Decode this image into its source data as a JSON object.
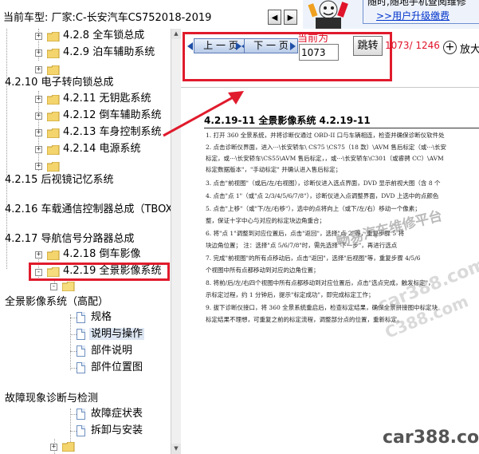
{
  "header": {
    "vehicle_line": "当前车型:  厂家:C-长安汽车CS752018-2019",
    "nav_left_glyph": "◀",
    "nav_right_glyph": "▶",
    "banner_line1": "随时,随地手机查阅维修",
    "banner_line2": ">>用户升级缴费"
  },
  "tree": {
    "rows": [
      {
        "label": "4.2.8 全车锁总成"
      },
      {
        "label": "4.2.9 泊车辅助系统"
      },
      {
        "label": "4.2.10 电子转向锁总成"
      },
      {
        "label": "4.2.11 无钥匙系统"
      },
      {
        "label": "4.2.12 倒车辅助系统"
      },
      {
        "label": "4.2.13 车身控制系统"
      },
      {
        "label": "4.2.14 电源系统"
      },
      {
        "label": "4.2.15 后视镜记忆系统"
      },
      {
        "label": "4.2.16 车载通信控制器总成（TBOX"
      },
      {
        "label": "4.2.17 导航信号分路器总成"
      },
      {
        "label": "4.2.18 倒车影像"
      },
      {
        "label": "4.2.19 全景影像系统"
      },
      {
        "label": "全景影像系统（高配）"
      },
      {
        "label": "规格"
      },
      {
        "label": "说明与操作"
      },
      {
        "label": "部件说明"
      },
      {
        "label": "部件位置图"
      },
      {
        "label": "故障现象诊断与检测"
      },
      {
        "label": "故障症状表"
      },
      {
        "label": "拆卸与安装"
      }
    ],
    "collapsed_glyph": "+",
    "expanded_glyph": "-"
  },
  "toolbar": {
    "prev_label": "上 一 页",
    "next_label": "下 一 页",
    "current_label": "当前为",
    "page_value": "1073",
    "jump_label": "跳转",
    "page_count": "1073/ 1246",
    "zoom_glyph": "+",
    "zoom_label": "放大"
  },
  "page": {
    "heading": "4.2.19-11 全景影像系统 4.2.19-11",
    "steps": [
      "1.  打开 360 全景系统，并将诊断仪通过 OBD-II 口与车辆相连，检查并确保诊断仪软件处",
      "2.  点击诊断仪界面，进入···\\长安轿车\\ CS75 \\CS75（18 款）\\AVM 售后标定（或···\\长安",
      "    标定，或···\\长安轿车\\CS55\\AVM 售后标定，，或···\\长安轿车\\C301（或睿骋 CC）\\AVM",
      "    标定数据版本\"，\"手动标定\"  并确认进入售后标定；",
      "3.  点击\"前视图\"（或后/左/右视图），诊断仪进入选点界面，DVD 显示前视大图（含 8 个",
      "4.  点击\"点 1\"（或\"点 2/3/4/5/6/7/8\"），诊断仪进入点调整界面，DVD 上选中的点颜色",
      "5.  点击\"上移\"（或\"下/左/右移\"），选中的点将向上（或下/左/右）移动一个像素；",
      "    整，保证十字中心与对应的标定块边角重合；",
      "6.  将\"点 1\"调整到对应位置后，点击\"返回\"，选择\"点 2\"等，重复步骤 5 将",
      "    块边角位置；  注：选择\"点 5/6/7/8\"时，需先选择\"下一步\"，再进行选点",
      "7.  完成\"前视图\"的所有点移动后，点击\"返回\"，选择\"后视图\"等，重复步骤 4/5/6",
      "    个视图中所有点都移动到对应的边角位置；",
      "8.  将前/后/左/右四个视图中所有点都移动到对应位置后，点击\"选点完成，触发标定\"，",
      "    示标定过程，约 1 分钟后，提示\"标定成功\"，即完成标定工作；",
      "9.  拔下诊断仪接口，将 360 全景系统重启后，检查标定结果，确保全景拼接图中标定块",
      "    标定结果不理想，可重复之前的标定流程，调整部分点的位置，重新标定。"
    ]
  },
  "watermarks": {
    "main": "畅易汽车维修平台",
    "site": "car388.com",
    "faint_1": "car388.com",
    "faint_2": "C388.com"
  },
  "colors": {
    "highlight": "#e01b2c",
    "page_count": "#e0142a",
    "link": "#0033cc"
  }
}
